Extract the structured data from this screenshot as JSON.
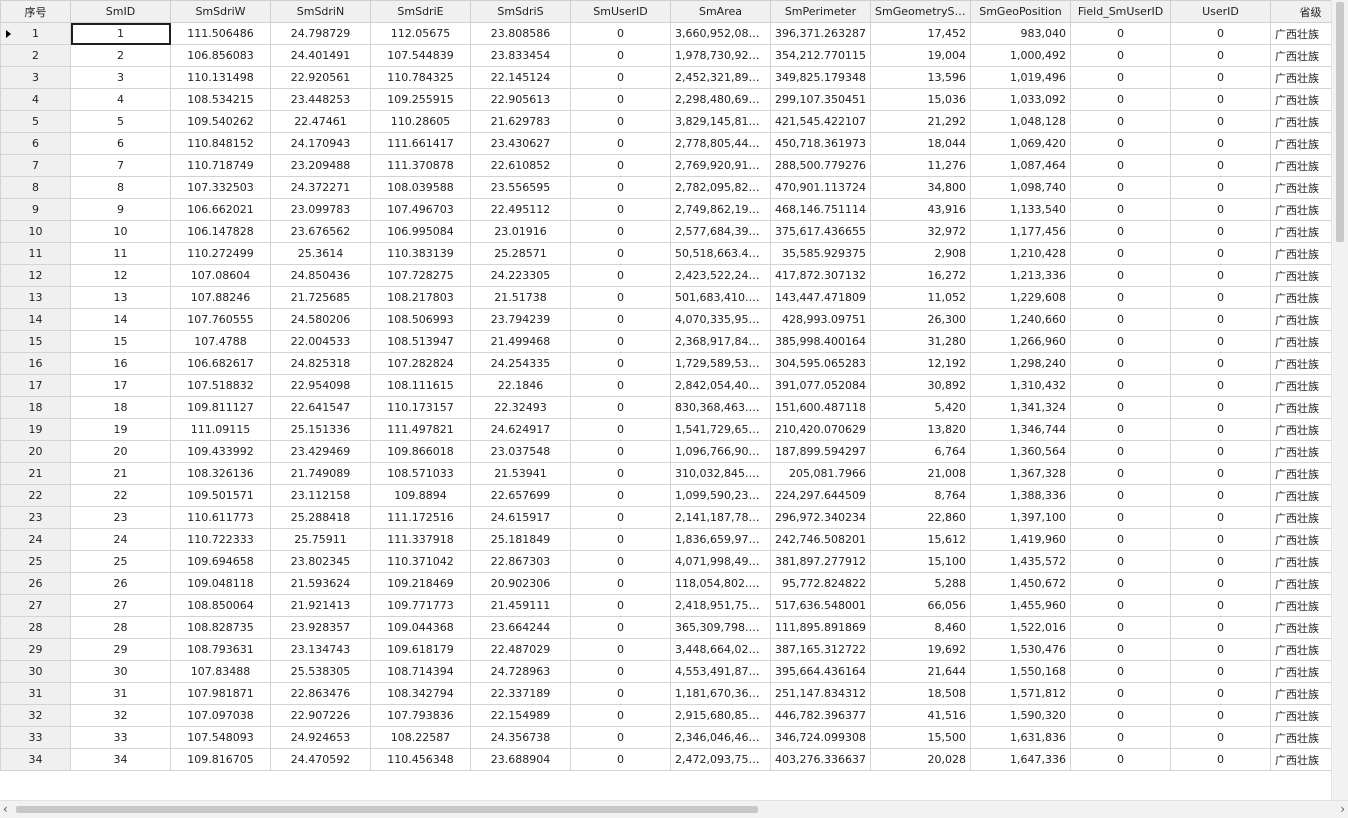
{
  "columns": [
    "序号",
    "SmID",
    "SmSdriW",
    "SmSdriN",
    "SmSdriE",
    "SmSdriS",
    "SmUserID",
    "SmArea",
    "SmPerimeter",
    "SmGeometrySize",
    "SmGeoPosition",
    "Field_SmUserID",
    "UserID",
    "省级"
  ],
  "rows": [
    [
      "1",
      "1",
      "111.506486",
      "24.798729",
      "112.05675",
      "23.808586",
      "0",
      "3,660,952,086....",
      "396,371.263287",
      "17,452",
      "983,040",
      "0",
      "0",
      "广西壮族"
    ],
    [
      "2",
      "2",
      "106.856083",
      "24.401491",
      "107.544839",
      "23.833454",
      "0",
      "1,978,730,927....",
      "354,212.770115",
      "19,004",
      "1,000,492",
      "0",
      "0",
      "广西壮族"
    ],
    [
      "3",
      "3",
      "110.131498",
      "22.920561",
      "110.784325",
      "22.145124",
      "0",
      "2,452,321,892....",
      "349,825.179348",
      "13,596",
      "1,019,496",
      "0",
      "0",
      "广西壮族"
    ],
    [
      "4",
      "4",
      "108.534215",
      "23.448253",
      "109.255915",
      "22.905613",
      "0",
      "2,298,480,693....",
      "299,107.350451",
      "15,036",
      "1,033,092",
      "0",
      "0",
      "广西壮族"
    ],
    [
      "5",
      "5",
      "109.540262",
      "22.47461",
      "110.28605",
      "21.629783",
      "0",
      "3,829,145,815....",
      "421,545.422107",
      "21,292",
      "1,048,128",
      "0",
      "0",
      "广西壮族"
    ],
    [
      "6",
      "6",
      "110.848152",
      "24.170943",
      "111.661417",
      "23.430627",
      "0",
      "2,778,805,444....",
      "450,718.361973",
      "18,044",
      "1,069,420",
      "0",
      "0",
      "广西壮族"
    ],
    [
      "7",
      "7",
      "110.718749",
      "23.209488",
      "111.370878",
      "22.610852",
      "0",
      "2,769,920,913....",
      "288,500.779276",
      "11,276",
      "1,087,464",
      "0",
      "0",
      "广西壮族"
    ],
    [
      "8",
      "8",
      "107.332503",
      "24.372271",
      "108.039588",
      "23.556595",
      "0",
      "2,782,095,825....",
      "470,901.113724",
      "34,800",
      "1,098,740",
      "0",
      "0",
      "广西壮族"
    ],
    [
      "9",
      "9",
      "106.662021",
      "23.099783",
      "107.496703",
      "22.495112",
      "0",
      "2,749,862,193....",
      "468,146.751114",
      "43,916",
      "1,133,540",
      "0",
      "0",
      "广西壮族"
    ],
    [
      "10",
      "10",
      "106.147828",
      "23.676562",
      "106.995084",
      "23.01916",
      "0",
      "2,577,684,395....",
      "375,617.436655",
      "32,972",
      "1,177,456",
      "0",
      "0",
      "广西壮族"
    ],
    [
      "11",
      "11",
      "110.272499",
      "25.3614",
      "110.383139",
      "25.28571",
      "0",
      "50,518,663.459...",
      "35,585.929375",
      "2,908",
      "1,210,428",
      "0",
      "0",
      "广西壮族"
    ],
    [
      "12",
      "12",
      "107.08604",
      "24.850436",
      "107.728275",
      "24.223305",
      "0",
      "2,423,522,242....",
      "417,872.307132",
      "16,272",
      "1,213,336",
      "0",
      "0",
      "广西壮族"
    ],
    [
      "13",
      "13",
      "107.88246",
      "21.725685",
      "108.217803",
      "21.51738",
      "0",
      "501,683,410.80...",
      "143,447.471809",
      "11,052",
      "1,229,608",
      "0",
      "0",
      "广西壮族"
    ],
    [
      "14",
      "14",
      "107.760555",
      "24.580206",
      "108.506993",
      "23.794239",
      "0",
      "4,070,335,958....",
      "428,993.09751",
      "26,300",
      "1,240,660",
      "0",
      "0",
      "广西壮族"
    ],
    [
      "15",
      "15",
      "107.4788",
      "22.004533",
      "108.513947",
      "21.499468",
      "0",
      "2,368,917,843....",
      "385,998.400164",
      "31,280",
      "1,266,960",
      "0",
      "0",
      "广西壮族"
    ],
    [
      "16",
      "16",
      "106.682617",
      "24.825318",
      "107.282824",
      "24.254335",
      "0",
      "1,729,589,534....",
      "304,595.065283",
      "12,192",
      "1,298,240",
      "0",
      "0",
      "广西壮族"
    ],
    [
      "17",
      "17",
      "107.518832",
      "22.954098",
      "108.111615",
      "22.1846",
      "0",
      "2,842,054,403....",
      "391,077.052084",
      "30,892",
      "1,310,432",
      "0",
      "0",
      "广西壮族"
    ],
    [
      "18",
      "18",
      "109.811127",
      "22.641547",
      "110.173157",
      "22.32493",
      "0",
      "830,368,463.75...",
      "151,600.487118",
      "5,420",
      "1,341,324",
      "0",
      "0",
      "广西壮族"
    ],
    [
      "19",
      "19",
      "111.09115",
      "25.151336",
      "111.497821",
      "24.624917",
      "0",
      "1,541,729,656....",
      "210,420.070629",
      "13,820",
      "1,346,744",
      "0",
      "0",
      "广西壮族"
    ],
    [
      "20",
      "20",
      "109.433992",
      "23.429469",
      "109.866018",
      "23.037548",
      "0",
      "1,096,766,908....",
      "187,899.594297",
      "6,764",
      "1,360,564",
      "0",
      "0",
      "广西壮族"
    ],
    [
      "21",
      "21",
      "108.326136",
      "21.749089",
      "108.571033",
      "21.53941",
      "0",
      "310,032,845.10...",
      "205,081.7966",
      "21,008",
      "1,367,328",
      "0",
      "0",
      "广西壮族"
    ],
    [
      "22",
      "22",
      "109.501571",
      "23.112158",
      "109.8894",
      "22.657699",
      "0",
      "1,099,590,233....",
      "224,297.644509",
      "8,764",
      "1,388,336",
      "0",
      "0",
      "广西壮族"
    ],
    [
      "23",
      "23",
      "110.611773",
      "25.288418",
      "111.172516",
      "24.615917",
      "0",
      "2,141,187,785....",
      "296,972.340234",
      "22,860",
      "1,397,100",
      "0",
      "0",
      "广西壮族"
    ],
    [
      "24",
      "24",
      "110.722333",
      "25.75911",
      "111.337918",
      "25.181849",
      "0",
      "1,836,659,970....",
      "242,746.508201",
      "15,612",
      "1,419,960",
      "0",
      "0",
      "广西壮族"
    ],
    [
      "25",
      "25",
      "109.694658",
      "23.802345",
      "110.371042",
      "22.867303",
      "0",
      "4,071,998,491....",
      "381,897.277912",
      "15,100",
      "1,435,572",
      "0",
      "0",
      "广西壮族"
    ],
    [
      "26",
      "26",
      "109.048118",
      "21.593624",
      "109.218469",
      "20.902306",
      "0",
      "118,054,802.86...",
      "95,772.824822",
      "5,288",
      "1,450,672",
      "0",
      "0",
      "广西壮族"
    ],
    [
      "27",
      "27",
      "108.850064",
      "21.921413",
      "109.771773",
      "21.459111",
      "0",
      "2,418,951,753....",
      "517,636.548001",
      "66,056",
      "1,455,960",
      "0",
      "0",
      "广西壮族"
    ],
    [
      "28",
      "28",
      "108.828735",
      "23.928357",
      "109.044368",
      "23.664244",
      "0",
      "365,309,798.19...",
      "111,895.891869",
      "8,460",
      "1,522,016",
      "0",
      "0",
      "广西壮族"
    ],
    [
      "29",
      "29",
      "108.793631",
      "23.134743",
      "109.618179",
      "22.487029",
      "0",
      "3,448,664,022....",
      "387,165.312722",
      "19,692",
      "1,530,476",
      "0",
      "0",
      "广西壮族"
    ],
    [
      "30",
      "30",
      "107.83488",
      "25.538305",
      "108.714394",
      "24.728963",
      "0",
      "4,553,491,876....",
      "395,664.436164",
      "21,644",
      "1,550,168",
      "0",
      "0",
      "广西壮族"
    ],
    [
      "31",
      "31",
      "107.981871",
      "22.863476",
      "108.342794",
      "22.337189",
      "0",
      "1,181,670,363....",
      "251,147.834312",
      "18,508",
      "1,571,812",
      "0",
      "0",
      "广西壮族"
    ],
    [
      "32",
      "32",
      "107.097038",
      "22.907226",
      "107.793836",
      "22.154989",
      "0",
      "2,915,680,855....",
      "446,782.396377",
      "41,516",
      "1,590,320",
      "0",
      "0",
      "广西壮族"
    ],
    [
      "33",
      "33",
      "107.548093",
      "24.924653",
      "108.22587",
      "24.356738",
      "0",
      "2,346,046,461....",
      "346,724.099308",
      "15,500",
      "1,631,836",
      "0",
      "0",
      "广西壮族"
    ],
    [
      "34",
      "34",
      "109.816705",
      "24.470592",
      "110.456348",
      "23.688904",
      "0",
      "2,472,093,759....",
      "403,276.336637",
      "20,028",
      "1,647,336",
      "0",
      "0",
      "广西壮族"
    ]
  ]
}
